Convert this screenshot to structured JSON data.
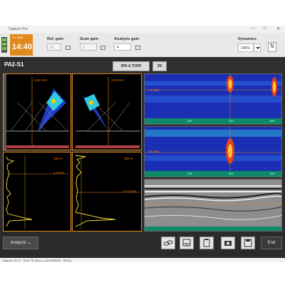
{
  "window": {
    "title": "Capture Pro",
    "min": "—",
    "max": "□",
    "close": "✕"
  },
  "toolbar": {
    "time_small": "3 x 3628",
    "time": "14:40",
    "ref_gain_label": "Ref. gain",
    "ref_gain_value": "60",
    "scan_gain_label": "Scan gain",
    "scan_gain_value": "0",
    "analysis_gain_label": "Analysis gain",
    "analysis_gain_value": "4",
    "dynamics_label": "Dynamics",
    "dynamics_value": "100%",
    "settings_icon": "sliders-icon"
  },
  "view": {
    "title": "PA2-S1",
    "tabs": [
      "2PA & TOFD",
      "3D"
    ]
  },
  "panels": {
    "sector1_label": "-0.04 mm",
    "sector2_label": "3.63 mm",
    "ascan1_top": "100 %",
    "ascan1_mid": "4.3 mm",
    "ascan2_top": "100 %",
    "ascan2_mid": "8.73 mm",
    "cscan1_label": "45 deg",
    "cscan2_label": "60 deg",
    "cscan_ticks": [
      "200",
      "400",
      "600"
    ]
  },
  "bottom": {
    "analysis_label": "Analysis",
    "end_label": "End",
    "icons": [
      "link-icon",
      "layout-icon",
      "clipboard-icon",
      "camera-icon",
      "save-icon"
    ]
  },
  "status": "Capture v3.1.2 · Rohr 70 Jahre_1 (2018/08/09 - 09:02)",
  "colors": {
    "accent": "#e08a1e",
    "scan_bg": "#1a2fb4",
    "dark": "#2b2b2b"
  }
}
